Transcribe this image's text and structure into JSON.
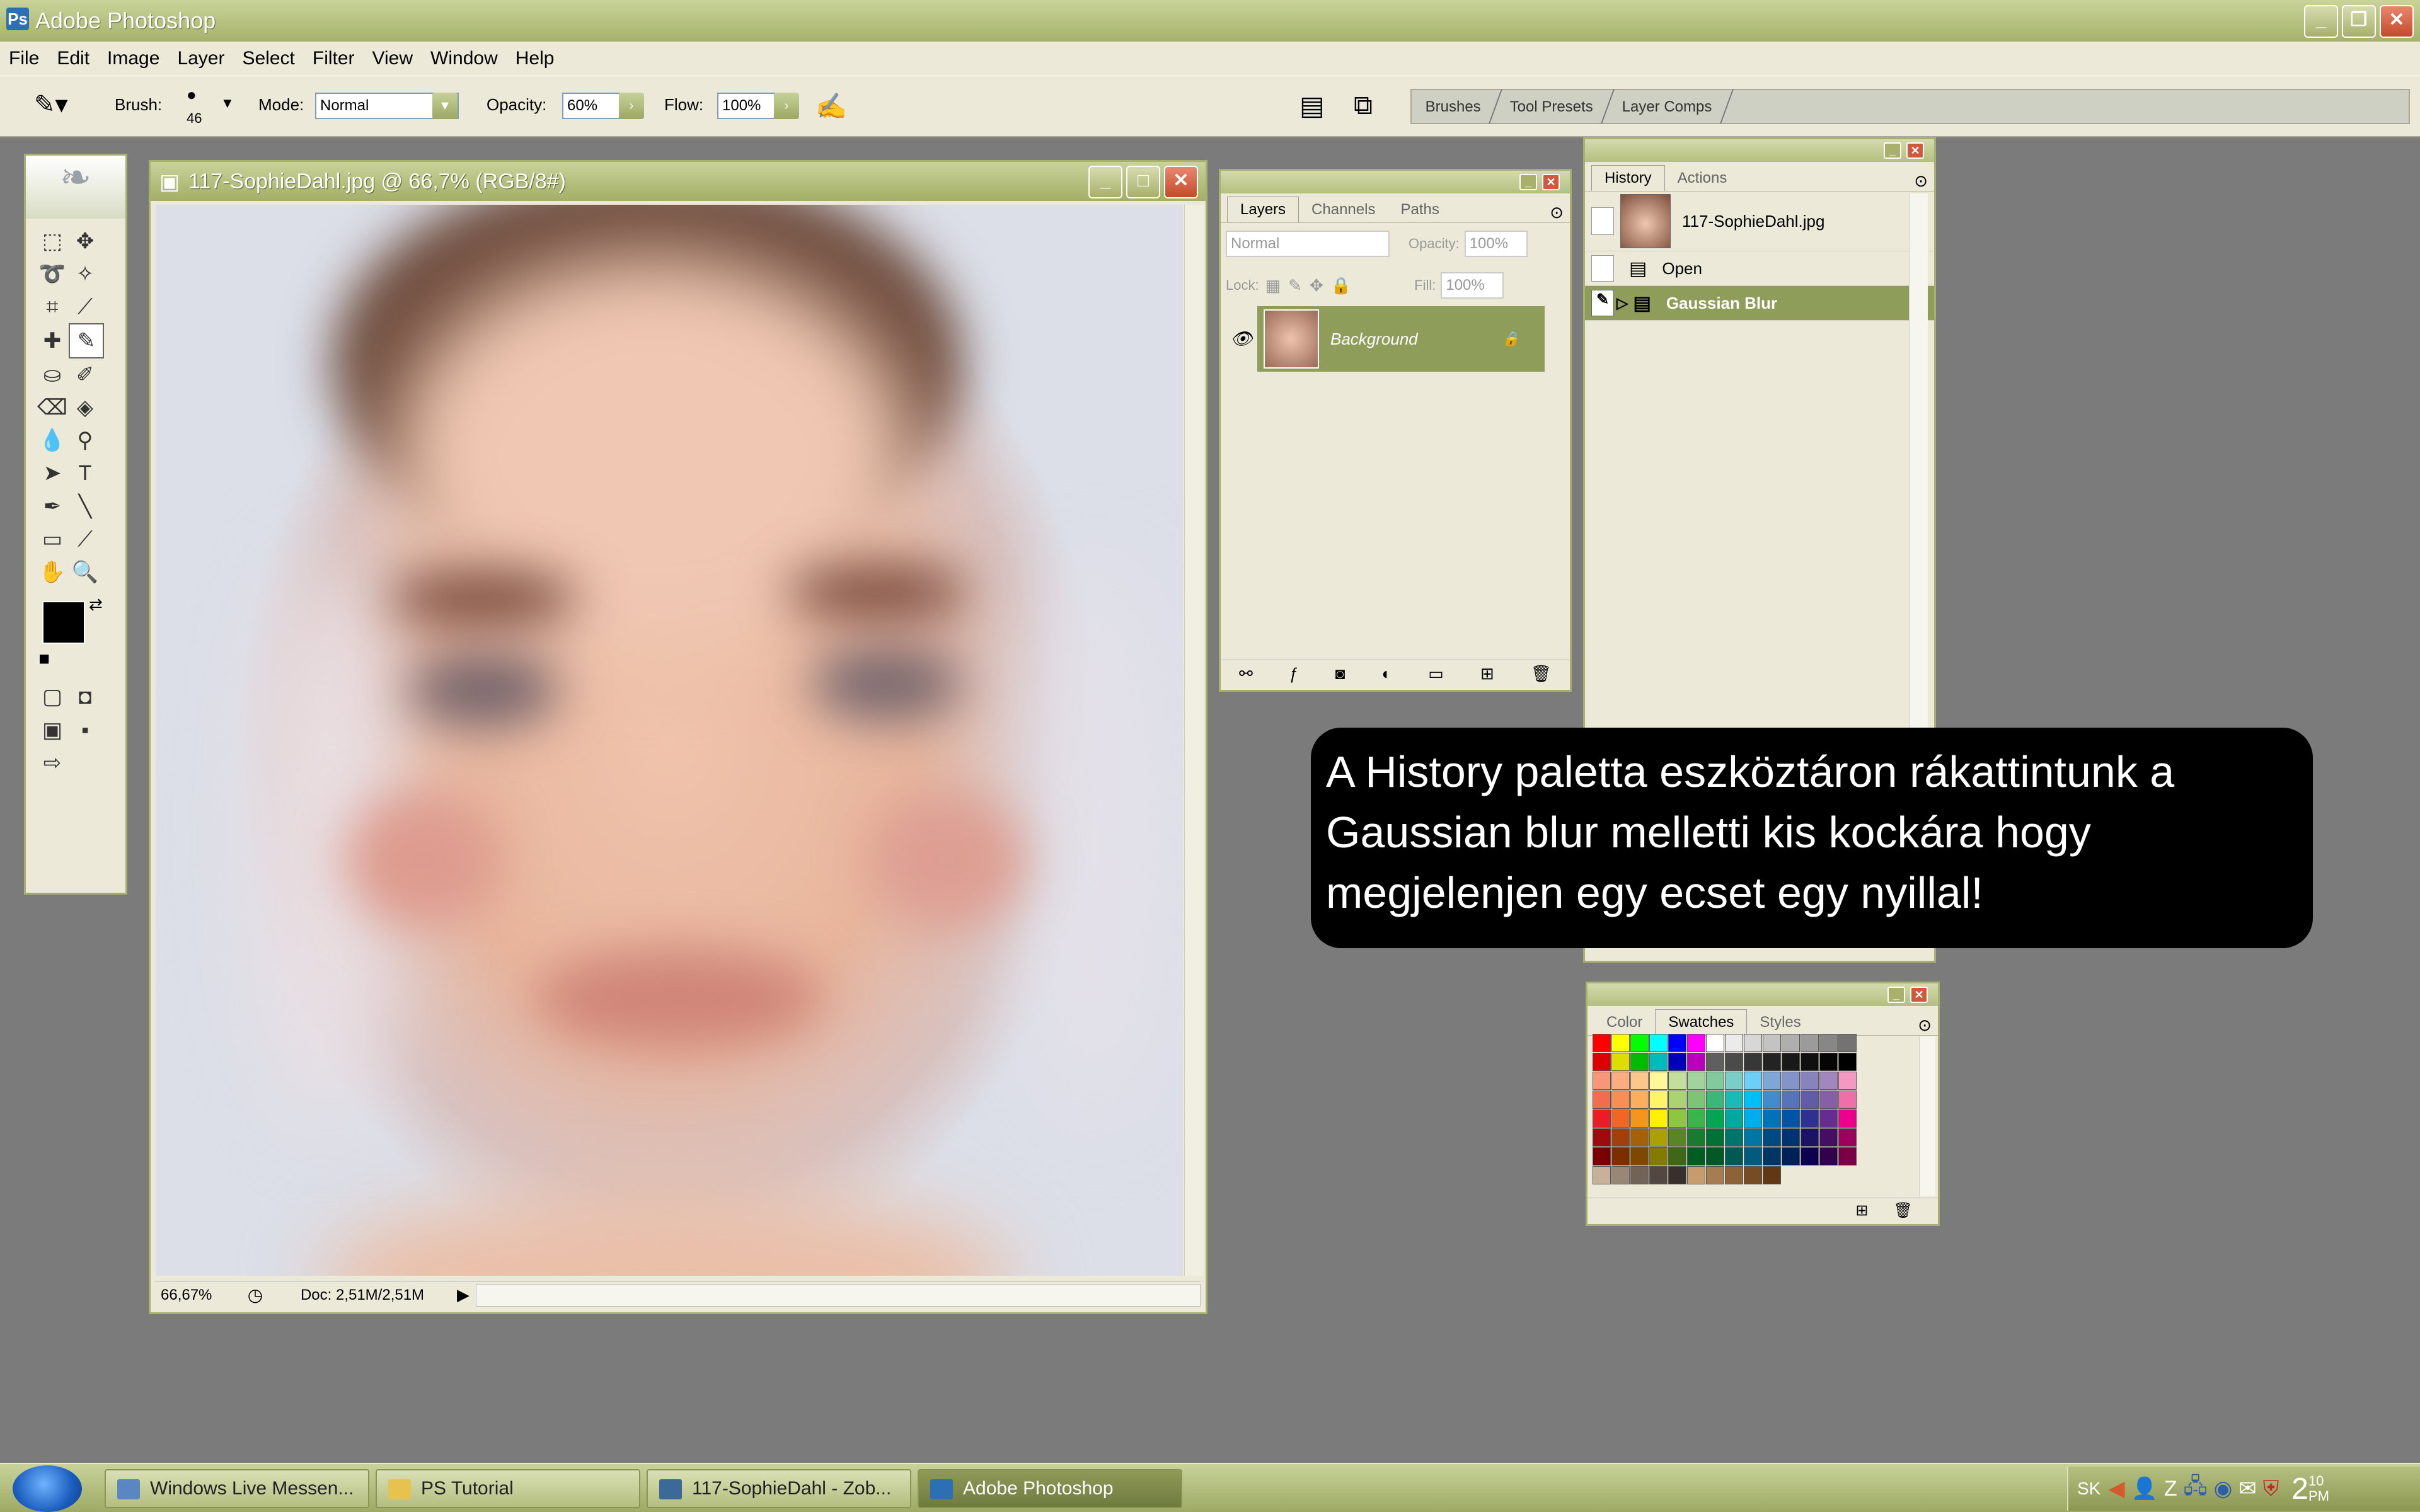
{
  "app": {
    "title": "Adobe Photoshop",
    "window_controls": [
      "minimize",
      "restore",
      "close"
    ]
  },
  "menu": [
    "File",
    "Edit",
    "Image",
    "Layer",
    "Select",
    "Filter",
    "View",
    "Window",
    "Help"
  ],
  "options_bar": {
    "brush_label": "Brush:",
    "brush_size": "46",
    "mode_label": "Mode:",
    "mode_value": "Normal",
    "opacity_label": "Opacity:",
    "opacity_value": "60%",
    "flow_label": "Flow:",
    "flow_value": "100%",
    "palette_well_tabs": [
      "Brushes",
      "Tool Presets",
      "Layer Comps"
    ]
  },
  "document": {
    "title": "117-SophieDahl.jpg @ 66,7% (RGB/8#)",
    "zoom": "66,67%",
    "doc_size": "Doc: 2,51M/2,51M"
  },
  "layers_panel": {
    "tabs": [
      "Layers",
      "Channels",
      "Paths"
    ],
    "blend_mode": "Normal",
    "opacity_label": "Opacity:",
    "opacity_value": "100%",
    "lock_label": "Lock:",
    "fill_label": "Fill:",
    "fill_value": "100%",
    "layer_name": "Background"
  },
  "history_panel": {
    "tabs": [
      "History",
      "Actions"
    ],
    "snapshot": "117-SophieDahl.jpg",
    "steps": [
      "Open",
      "Gaussian Blur"
    ]
  },
  "swatches_panel": {
    "tabs": [
      "Color",
      "Swatches",
      "Styles"
    ]
  },
  "swatch_rows": [
    [
      "#ff0000",
      "#ffff00",
      "#00ff00",
      "#00ffff",
      "#0000ff",
      "#ff00ff",
      "#ffffff",
      "#ebebeb",
      "#d7d7d7",
      "#c3c3c3",
      "#afafaf",
      "#9b9b9b",
      "#878787",
      "#737373"
    ],
    [
      "#dd0000",
      "#dddd00",
      "#00bb00",
      "#00bbbb",
      "#0000bb",
      "#bb00bb",
      "#5f5f5f",
      "#4b4b4b",
      "#373737",
      "#232323",
      "#191919",
      "#0f0f0f",
      "#050505",
      "#000000"
    ],
    [
      "#f7977a",
      "#f9ad81",
      "#fdc68a",
      "#fff79a",
      "#c4df9b",
      "#a2d39c",
      "#82ca9d",
      "#7bcdc8",
      "#6ecff6",
      "#7ea7d8",
      "#8493ca",
      "#8882be",
      "#a187be",
      "#f49ac2"
    ],
    [
      "#f26c4f",
      "#f68e55",
      "#fbaf5c",
      "#fff467",
      "#acd372",
      "#7cc576",
      "#3bb878",
      "#1abbb4",
      "#00bff3",
      "#438ccb",
      "#5574b9",
      "#605ca8",
      "#855fa8",
      "#f06ea9"
    ],
    [
      "#ed1c24",
      "#f26522",
      "#f7941d",
      "#fff200",
      "#8dc63f",
      "#39b54a",
      "#00a651",
      "#00a99d",
      "#00aeef",
      "#0072bc",
      "#0054a6",
      "#2e3192",
      "#662d91",
      "#ec008c"
    ],
    [
      "#9e0b0f",
      "#a0410d",
      "#a36209",
      "#aba000",
      "#598527",
      "#197b30",
      "#007236",
      "#00746b",
      "#0076a3",
      "#004a80",
      "#003471",
      "#1b1464",
      "#440e62",
      "#9e005d"
    ],
    [
      "#790000",
      "#7b2e00",
      "#7d4900",
      "#827b00",
      "#406618",
      "#005e20",
      "#005826",
      "#005952",
      "#005b7f",
      "#003663",
      "#002157",
      "#0d004c",
      "#32004b",
      "#7b0046"
    ],
    [
      "#c7b299",
      "#998675",
      "#736357",
      "#534741",
      "#37302d",
      "#c69c6d",
      "#a67c52",
      "#8c6239",
      "#754c24",
      "#603813"
    ]
  ],
  "callout": {
    "line1": "A History paletta eszköztáron rákattintunk a",
    "line2": "Gaussian blur melletti kis kockára hogy",
    "line3": "megjelenjen egy ecset egy nyillal!"
  },
  "taskbar": {
    "items": [
      "Windows Live Messen...",
      "PS Tutorial",
      "117-SophieDahl - Zob...",
      "Adobe Photoshop"
    ],
    "tray_lang": "SK",
    "clock_hour": "2",
    "clock_min": "10",
    "clock_ampm": "PM"
  }
}
